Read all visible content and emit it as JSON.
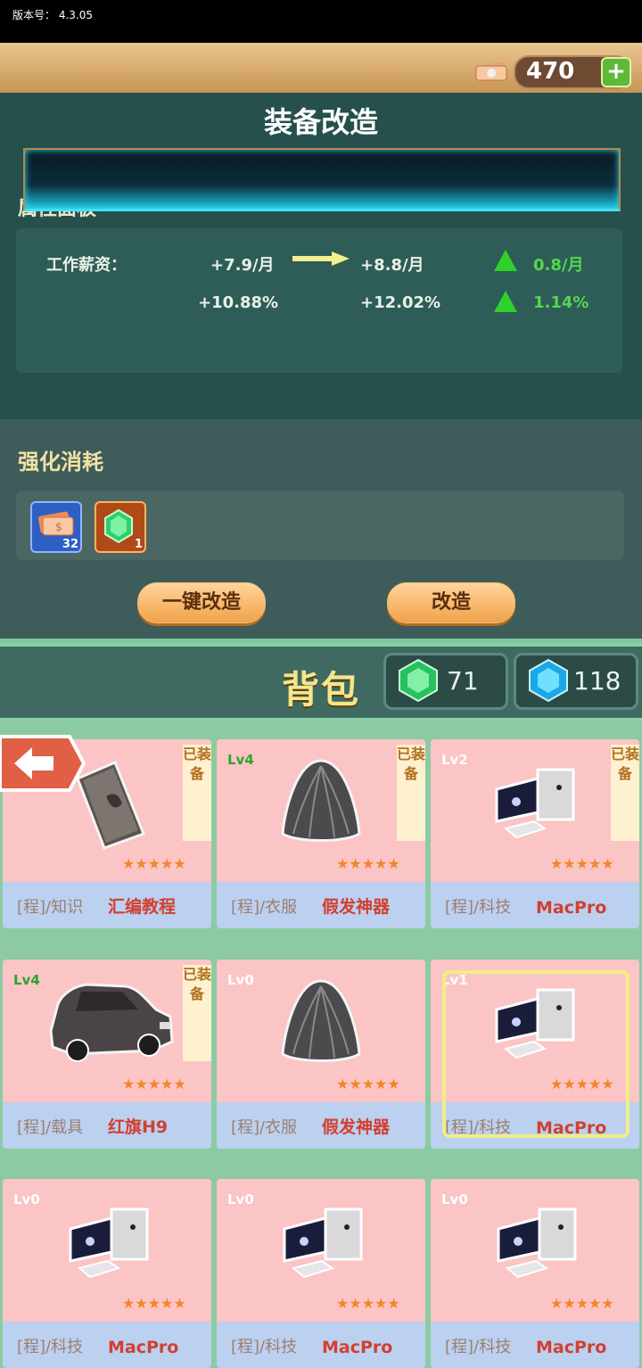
{
  "status": {
    "version": "版本号：  4.3.05"
  },
  "header": {
    "coins": "470"
  },
  "panel": {
    "title": "装备改造",
    "attr_label": "属性面板",
    "row1": {
      "label": "工作薪资：",
      "from": "+7.9/月",
      "to": "+8.8/月",
      "delta": "0.8/月"
    },
    "row2": {
      "from": "+10.88%",
      "to": "+12.02%",
      "delta": "1.14%"
    }
  },
  "cost": {
    "label": "强化消耗",
    "items": [
      {
        "icon": "cash-icon",
        "count": "32"
      },
      {
        "icon": "green-gem-icon",
        "count": "1"
      }
    ],
    "btn_one_key": "一键改造",
    "btn_modify": "改造"
  },
  "bag": {
    "title": "背包",
    "green_gems": "71",
    "blue_gems": "118"
  },
  "cards": [
    {
      "level": "",
      "category": "[程]/知识",
      "name": "汇编教程",
      "equipped": "已装备",
      "image": "book-icon"
    },
    {
      "level": "Lv4",
      "category": "[程]/衣服",
      "name": "假发神器",
      "equipped": "已装备",
      "image": "wig-icon"
    },
    {
      "level": "Lv2",
      "category": "[程]/科技",
      "name": "MacPro",
      "equipped": "已装备",
      "image": "computer-icon"
    },
    {
      "level": "Lv4",
      "category": "[程]/载具",
      "name": "红旗H9",
      "equipped": "已装备",
      "image": "car-icon"
    },
    {
      "level": "Lv0",
      "category": "[程]/衣服",
      "name": "假发神器",
      "equipped": "",
      "image": "wig-icon"
    },
    {
      "level": "Lv1",
      "category": "[程]/科技",
      "name": "MacPro",
      "equipped": "",
      "image": "computer-icon"
    },
    {
      "level": "Lv0",
      "category": "[程]/科技",
      "name": "MacPro",
      "equipped": "",
      "image": "computer-icon"
    },
    {
      "level": "Lv0",
      "category": "[程]/科技",
      "name": "MacPro",
      "equipped": "",
      "image": "computer-icon"
    },
    {
      "level": "Lv0",
      "category": "[程]/科技",
      "name": "MacPro",
      "equipped": "",
      "image": "computer-icon"
    }
  ],
  "colors": {
    "accent_green": "#53d84b",
    "name_red": "#d14030",
    "button_orange": "#f0a24a"
  }
}
